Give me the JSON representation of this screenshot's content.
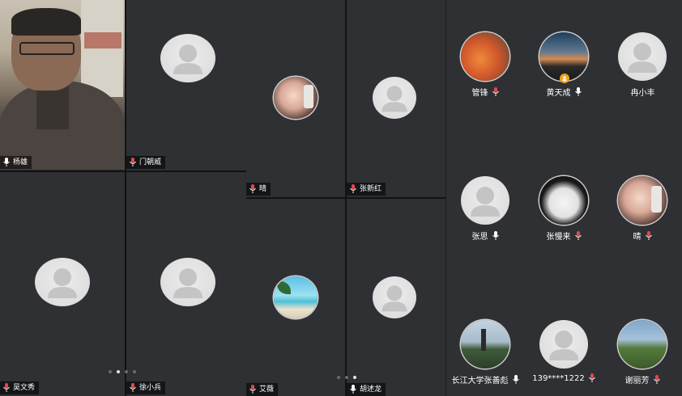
{
  "screen1": {
    "tiles": [
      {
        "name": "杨雄",
        "type": "camera"
      },
      {
        "name": "门朝威",
        "type": "default"
      },
      {
        "name": "吴文秀",
        "type": "default"
      },
      {
        "name": "徐小兵",
        "type": "default"
      }
    ],
    "page_dots": 4,
    "active_dot": 1
  },
  "screen2": {
    "tiles": [
      {
        "name": "晴",
        "type": "photo-girl"
      },
      {
        "name": "张新红",
        "type": "default"
      },
      {
        "name": "艾薇",
        "type": "photo-beach"
      },
      {
        "name": "胡述龙",
        "type": "default"
      }
    ],
    "page_dots": 3,
    "active_dot": 2
  },
  "participants": [
    {
      "name": "管锋",
      "avatar": "photo-orange",
      "mic": "muted"
    },
    {
      "name": "黄天成",
      "avatar": "photo-sunset",
      "mic": "on",
      "host_badge": true
    },
    {
      "name": "冉小丰",
      "avatar": "default",
      "mic": "none"
    },
    {
      "name": "张思",
      "avatar": "default",
      "mic": "on"
    },
    {
      "name": "张慢来",
      "avatar": "photo-panda",
      "mic": "muted"
    },
    {
      "name": "晴",
      "avatar": "photo-girl",
      "mic": "muted"
    },
    {
      "name": "长江大学张善彪",
      "avatar": "photo-tower",
      "mic": "on"
    },
    {
      "name": "139****1222",
      "avatar": "default",
      "mic": "muted"
    },
    {
      "name": "谢丽芳",
      "avatar": "photo-hills",
      "mic": "muted"
    }
  ],
  "colors": {
    "muted_mic": "#e04848",
    "active_mic": "#ffffff",
    "tile_bg": "#2e3034",
    "host_badge": "#f0a01e"
  }
}
